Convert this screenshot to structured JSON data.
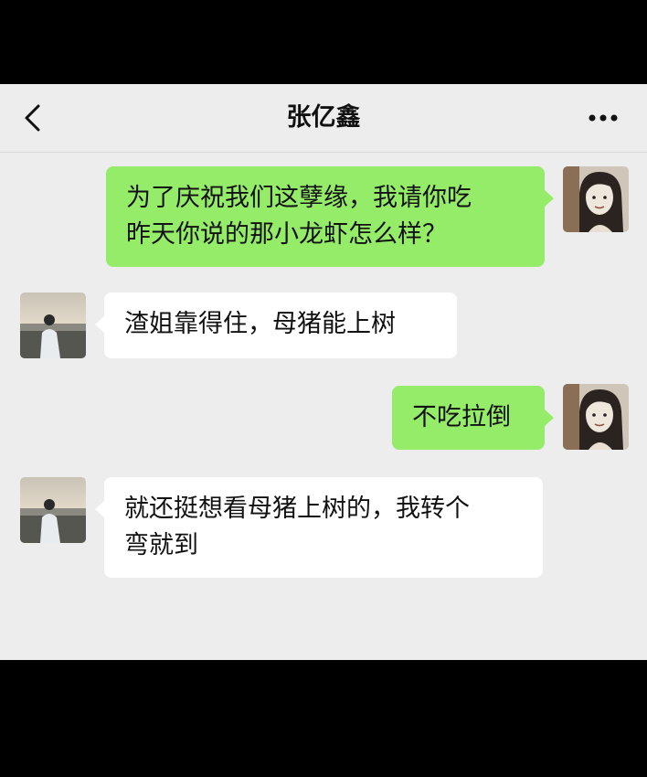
{
  "header": {
    "title": "张亿鑫",
    "back_icon": "chevron-left-icon",
    "more_icon": "more-dots-icon"
  },
  "colors": {
    "background": "#ededed",
    "my_bubble": "#95ec69",
    "their_bubble": "#ffffff",
    "outer": "#000000"
  },
  "messages": [
    {
      "sender": "me",
      "text": "为了庆祝我们这孽缘，我请你吃\n昨天你说的那小龙虾怎么样？"
    },
    {
      "sender": "them",
      "text": "渣姐靠得住，母猪能上树"
    },
    {
      "sender": "me",
      "text": "不吃拉倒"
    },
    {
      "sender": "them",
      "text": "就还挺想看母猪上树的，我转个\n弯就到"
    }
  ]
}
